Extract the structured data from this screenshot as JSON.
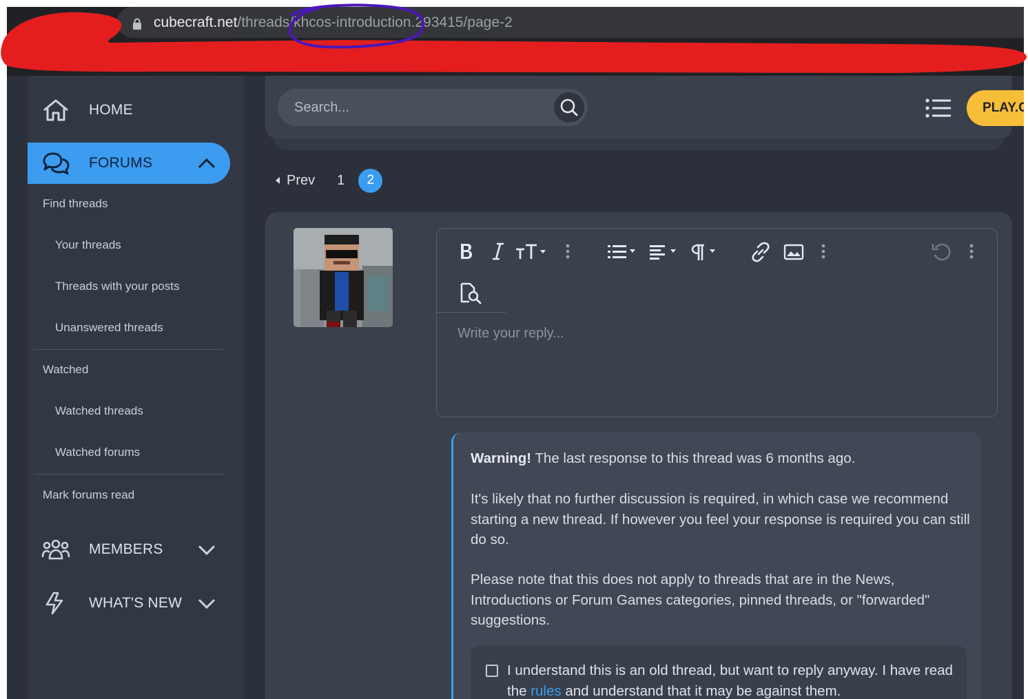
{
  "browser": {
    "url_host": "cubecraft.net",
    "url_path": "/threads/khcos-introduction.293415/page-2"
  },
  "sidebar": {
    "home": "HOME",
    "forums": "FORUMS",
    "forum_links": [
      "Find threads",
      "Your threads",
      "Threads with your posts",
      "Unanswered threads"
    ],
    "watched": "Watched",
    "watched_links": [
      "Watched threads",
      "Watched forums"
    ],
    "mark_read": "Mark forums read",
    "members": "MEMBERS",
    "whats_new": "WHAT'S NEW"
  },
  "header": {
    "search_placeholder": "Search...",
    "play_label": "PLAY.C"
  },
  "pagination": {
    "prev": "Prev",
    "page1": "1",
    "page2": "2",
    "current_page": 2
  },
  "editor": {
    "placeholder": "Write your reply...",
    "toolbar_icons": [
      "bold-icon",
      "italic-icon",
      "text-size-icon",
      "more-icon",
      "list-icon",
      "align-icon",
      "paragraph-icon",
      "link-icon",
      "image-icon",
      "more-icon",
      "undo-icon",
      "more-icon",
      "preview-icon"
    ]
  },
  "warning": {
    "title": "Warning!",
    "line1": "The last response to this thread was 6 months ago.",
    "para2": "It's likely that no further discussion is required, in which case we recommend starting a new thread. If however you feel your response is required you can still do so.",
    "para3": "Please note that this does not apply to threads that are in the News, Introductions or Forum Games categories, pinned threads, or \"forwarded\" suggestions.",
    "confirm_before": "I understand this is an old thread, but want to reply anyway. I have read the ",
    "confirm_link": "rules",
    "confirm_after": " and understand that it may be against them."
  },
  "colors": {
    "accent": "#3b9cf0",
    "play_button": "#f7be38",
    "background": "#2b303a",
    "panel": "#3a404c",
    "annotation_red": "#e41e1e",
    "annotation_purple": "#4a18b8"
  }
}
